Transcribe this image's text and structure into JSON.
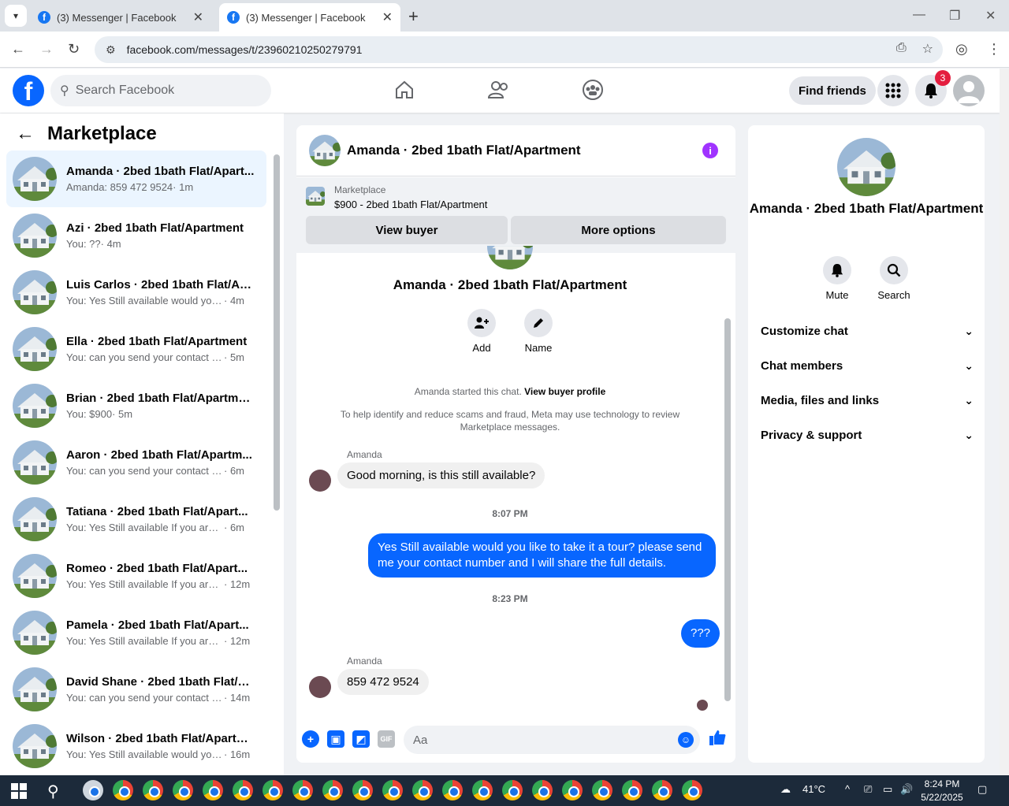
{
  "browser": {
    "tabs": [
      {
        "title": "(3) Messenger | Facebook",
        "active": false
      },
      {
        "title": "(3) Messenger | Facebook",
        "active": true
      }
    ],
    "url": "facebook.com/messages/t/23960210250279791"
  },
  "fb_header": {
    "search_placeholder": "Search Facebook",
    "find_friends": "Find friends",
    "notif_count": "3"
  },
  "sidebar": {
    "title": "Marketplace",
    "conversations": [
      {
        "name": "Amanda · 2bed 1bath Flat/Apart...",
        "snippet": "Amanda: 859 472 9524",
        "time": " · 1m",
        "selected": true
      },
      {
        "name": "Azi · 2bed 1bath Flat/Apartment",
        "snippet": "You: ??",
        "time": " · 4m"
      },
      {
        "name": "Luis Carlos · 2bed 1bath Flat/Ap...",
        "snippet": "You: Yes Still available would you li...",
        "time": " · 4m"
      },
      {
        "name": "Ella · 2bed 1bath Flat/Apartment",
        "snippet": "You: can you send your contact nu...",
        "time": " · 5m"
      },
      {
        "name": "Brian · 2bed 1bath Flat/Apartment",
        "snippet": "You: $900",
        "time": " · 5m"
      },
      {
        "name": "Aaron · 2bed 1bath Flat/Apartm...",
        "snippet": "You: can you send your contact nu...",
        "time": " · 6m"
      },
      {
        "name": "Tatiana · 2bed 1bath Flat/Apart...",
        "snippet": "You: Yes Still available If you are int...",
        "time": " · 6m"
      },
      {
        "name": "Romeo · 2bed 1bath Flat/Apart...",
        "snippet": "You: Yes Still available If you are i...",
        "time": " · 12m"
      },
      {
        "name": "Pamela · 2bed 1bath Flat/Apart...",
        "snippet": "You: Yes Still available If you are i...",
        "time": " · 12m"
      },
      {
        "name": "David Shane · 2bed 1bath Flat/A...",
        "snippet": "You: can you send your contact n...",
        "time": " · 14m"
      },
      {
        "name": "Wilson · 2bed 1bath Flat/Apartm...",
        "snippet": "You: Yes Still available would you ...",
        "time": " · 16m"
      }
    ]
  },
  "chat": {
    "title": "Amanda · 2bed 1bath Flat/Apartment",
    "listing": {
      "label": "Marketplace",
      "price_title": "$900 - 2bed 1bath Flat/Apartment",
      "view_buyer": "View buyer",
      "more_options": "More options"
    },
    "intro_title": "Amanda · 2bed 1bath Flat/Apartment",
    "actions": {
      "add": "Add",
      "name": "Name"
    },
    "started": "Amanda started this chat.",
    "view_buyer_profile": "View buyer profile",
    "notice": "To help identify and reduce scams and fraud, Meta may use technology to review Marketplace messages.",
    "messages": {
      "sender1": "Amanda",
      "msg1": "Good morning, is this still available?",
      "time1": "8:07 PM",
      "msg2": "Yes Still available would you like to take it a tour? please send me your contact number and I will share the full details.",
      "time2": "8:23 PM",
      "msg3": "???",
      "sender2": "Amanda",
      "msg4": "859 472 9524"
    },
    "composer_placeholder": "Aa"
  },
  "details": {
    "name": "Amanda · 2bed 1bath Flat/Apartment",
    "mute": "Mute",
    "search": "Search",
    "sections": [
      "Customize chat",
      "Chat members",
      "Media, files and links",
      "Privacy & support"
    ]
  },
  "taskbar": {
    "temp": "41°C",
    "time": "8:24 PM",
    "date": "5/22/2025"
  },
  "colors": {
    "accent": "#0866ff",
    "selected": "#ebf5ff",
    "badge": "#e41e3f",
    "info": "#a033ff"
  }
}
